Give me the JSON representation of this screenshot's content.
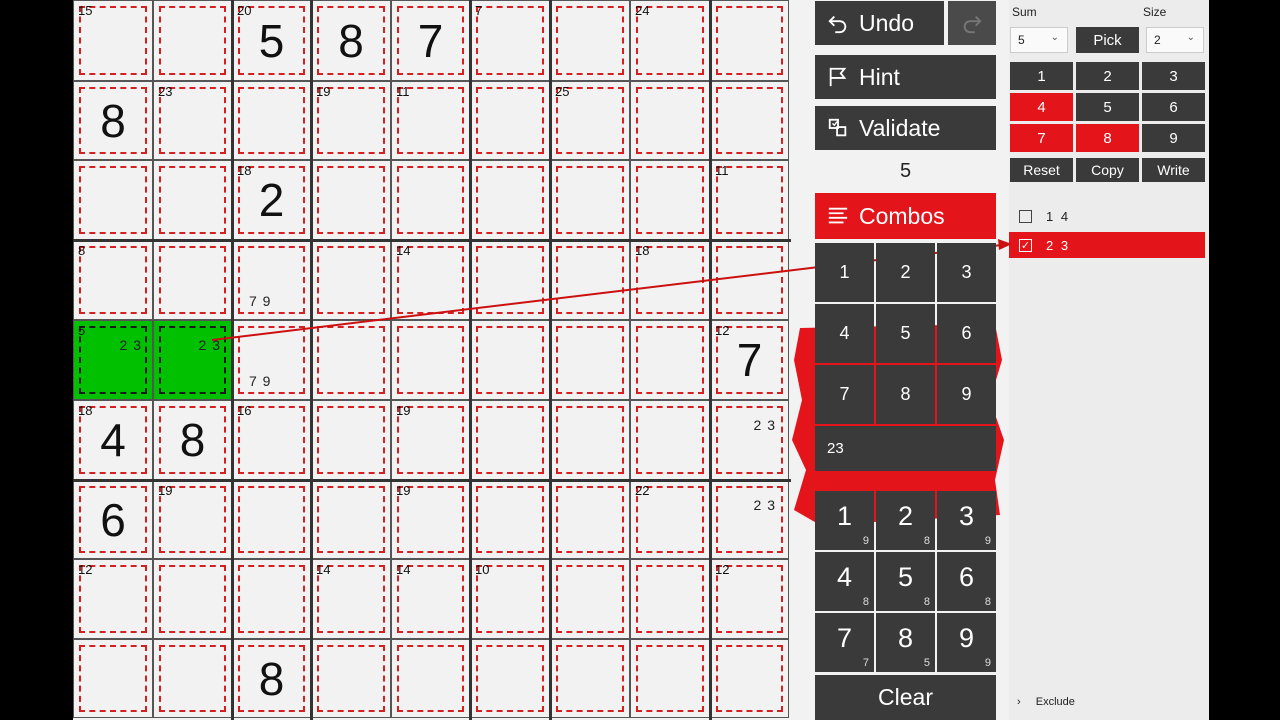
{
  "board": {
    "cells": [
      [
        {
          "sum": "15",
          "value": "",
          "cands": ""
        },
        {
          "sum": "",
          "value": "",
          "cands": ""
        },
        {
          "sum": "20",
          "value": "5",
          "cands": ""
        },
        {
          "sum": "",
          "value": "8",
          "cands": ""
        },
        {
          "sum": "",
          "value": "7",
          "cands": ""
        },
        {
          "sum": "7",
          "value": "",
          "cands": ""
        },
        {
          "sum": "",
          "value": "",
          "cands": ""
        },
        {
          "sum": "24",
          "value": "",
          "cands": ""
        },
        {
          "sum": "",
          "value": "",
          "cands": ""
        }
      ],
      [
        {
          "sum": "",
          "value": "8",
          "cands": ""
        },
        {
          "sum": "23",
          "value": "",
          "cands": ""
        },
        {
          "sum": "",
          "value": "",
          "cands": ""
        },
        {
          "sum": "19",
          "value": "",
          "cands": ""
        },
        {
          "sum": "11",
          "value": "",
          "cands": ""
        },
        {
          "sum": "",
          "value": "",
          "cands": ""
        },
        {
          "sum": "25",
          "value": "",
          "cands": ""
        },
        {
          "sum": "",
          "value": "",
          "cands": ""
        },
        {
          "sum": "",
          "value": "",
          "cands": ""
        }
      ],
      [
        {
          "sum": "",
          "value": "",
          "cands": ""
        },
        {
          "sum": "",
          "value": "",
          "cands": ""
        },
        {
          "sum": "18",
          "value": "2",
          "cands": ""
        },
        {
          "sum": "",
          "value": "",
          "cands": ""
        },
        {
          "sum": "",
          "value": "",
          "cands": ""
        },
        {
          "sum": "",
          "value": "",
          "cands": ""
        },
        {
          "sum": "",
          "value": "",
          "cands": ""
        },
        {
          "sum": "",
          "value": "",
          "cands": ""
        },
        {
          "sum": "11",
          "value": "",
          "cands": ""
        }
      ],
      [
        {
          "sum": "8",
          "value": "",
          "cands": ""
        },
        {
          "sum": "",
          "value": "",
          "cands": ""
        },
        {
          "sum": "",
          "value": "",
          "cands": "7  9"
        },
        {
          "sum": "",
          "value": "",
          "cands": ""
        },
        {
          "sum": "14",
          "value": "",
          "cands": ""
        },
        {
          "sum": "",
          "value": "",
          "cands": ""
        },
        {
          "sum": "",
          "value": "",
          "cands": ""
        },
        {
          "sum": "18",
          "value": "",
          "cands": ""
        },
        {
          "sum": "",
          "value": "",
          "cands": ""
        }
      ],
      [
        {
          "sum": "5",
          "value": "",
          "cands": "2 3"
        },
        {
          "sum": "",
          "value": "",
          "cands": "2 3"
        },
        {
          "sum": "",
          "value": "",
          "cands": "7  9"
        },
        {
          "sum": "",
          "value": "",
          "cands": ""
        },
        {
          "sum": "",
          "value": "",
          "cands": ""
        },
        {
          "sum": "",
          "value": "",
          "cands": ""
        },
        {
          "sum": "",
          "value": "",
          "cands": ""
        },
        {
          "sum": "",
          "value": "",
          "cands": ""
        },
        {
          "sum": "12",
          "value": "7",
          "cands": ""
        }
      ],
      [
        {
          "sum": "18",
          "value": "4",
          "cands": ""
        },
        {
          "sum": "",
          "value": "8",
          "cands": ""
        },
        {
          "sum": "16",
          "value": "",
          "cands": ""
        },
        {
          "sum": "",
          "value": "",
          "cands": ""
        },
        {
          "sum": "19",
          "value": "",
          "cands": ""
        },
        {
          "sum": "",
          "value": "",
          "cands": ""
        },
        {
          "sum": "",
          "value": "",
          "cands": ""
        },
        {
          "sum": "",
          "value": "",
          "cands": ""
        },
        {
          "sum": "",
          "value": "",
          "cands": "2 3"
        }
      ],
      [
        {
          "sum": "",
          "value": "6",
          "cands": ""
        },
        {
          "sum": "19",
          "value": "",
          "cands": ""
        },
        {
          "sum": "",
          "value": "",
          "cands": ""
        },
        {
          "sum": "",
          "value": "",
          "cands": ""
        },
        {
          "sum": "19",
          "value": "",
          "cands": ""
        },
        {
          "sum": "",
          "value": "",
          "cands": ""
        },
        {
          "sum": "",
          "value": "",
          "cands": ""
        },
        {
          "sum": "22",
          "value": "",
          "cands": ""
        },
        {
          "sum": "",
          "value": "",
          "cands": "2 3"
        }
      ],
      [
        {
          "sum": "12",
          "value": "",
          "cands": ""
        },
        {
          "sum": "",
          "value": "",
          "cands": ""
        },
        {
          "sum": "",
          "value": "",
          "cands": ""
        },
        {
          "sum": "14",
          "value": "",
          "cands": ""
        },
        {
          "sum": "14",
          "value": "",
          "cands": ""
        },
        {
          "sum": "10",
          "value": "",
          "cands": ""
        },
        {
          "sum": "",
          "value": "",
          "cands": ""
        },
        {
          "sum": "",
          "value": "",
          "cands": ""
        },
        {
          "sum": "12",
          "value": "",
          "cands": ""
        }
      ],
      [
        {
          "sum": "",
          "value": "",
          "cands": ""
        },
        {
          "sum": "",
          "value": "",
          "cands": ""
        },
        {
          "sum": "",
          "value": "8",
          "cands": ""
        },
        {
          "sum": "",
          "value": "",
          "cands": ""
        },
        {
          "sum": "",
          "value": "",
          "cands": ""
        },
        {
          "sum": "",
          "value": "",
          "cands": ""
        },
        {
          "sum": "",
          "value": "",
          "cands": ""
        },
        {
          "sum": "",
          "value": "",
          "cands": ""
        },
        {
          "sum": "",
          "value": "",
          "cands": ""
        }
      ]
    ],
    "highlighted": [
      [
        4,
        0
      ],
      [
        4,
        1
      ]
    ]
  },
  "toolbar": {
    "undo_label": "Undo",
    "hint_label": "Hint",
    "validate_label": "Validate",
    "cage_sum_display": "5",
    "combos_label": "Combos",
    "clear_label": "Clear"
  },
  "combo_grid": {
    "digits": [
      "1",
      "2",
      "3",
      "4",
      "5",
      "6",
      "7",
      "8",
      "9"
    ],
    "entry": "23"
  },
  "numpad": [
    {
      "n": "1",
      "c": "9"
    },
    {
      "n": "2",
      "c": "8"
    },
    {
      "n": "3",
      "c": "9"
    },
    {
      "n": "4",
      "c": "8"
    },
    {
      "n": "5",
      "c": "8"
    },
    {
      "n": "6",
      "c": "8"
    },
    {
      "n": "7",
      "c": "7"
    },
    {
      "n": "8",
      "c": "5"
    },
    {
      "n": "9",
      "c": "9"
    }
  ],
  "panel": {
    "sum_label": "Sum",
    "size_label": "Size",
    "sum_value": "5",
    "size_value": "2",
    "pick_label": "Pick",
    "digits": [
      {
        "d": "1",
        "state": "normal"
      },
      {
        "d": "2",
        "state": "normal"
      },
      {
        "d": "3",
        "state": "normal"
      },
      {
        "d": "4",
        "state": "red"
      },
      {
        "d": "5",
        "state": "normal"
      },
      {
        "d": "6",
        "state": "normal"
      },
      {
        "d": "7",
        "state": "red"
      },
      {
        "d": "8",
        "state": "red"
      },
      {
        "d": "9",
        "state": "normal"
      }
    ],
    "reset_label": "Reset",
    "copy_label": "Copy",
    "write_label": "Write",
    "combos": [
      {
        "text": "1 4",
        "checked": false
      },
      {
        "text": "2 3",
        "checked": true
      }
    ],
    "exclude_label": "Exclude"
  },
  "colors": {
    "accent_red": "#e3141a",
    "highlight_green": "#00c000",
    "button_dark": "#3a3a3a",
    "cage_line": "#d42020"
  }
}
